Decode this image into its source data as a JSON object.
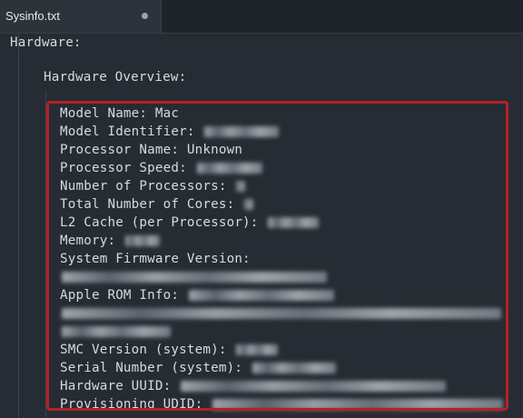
{
  "tab": {
    "title": "Sysinfo.txt"
  },
  "lines": {
    "hardware": "Hardware:",
    "overview": "Hardware Overview:",
    "model_name": "Model Name: Mac",
    "model_identifier": "Model Identifier:",
    "processor_name": "Processor Name: Unknown",
    "processor_speed": "Processor Speed:",
    "num_processors": "Number of Processors:",
    "total_cores": "Total Number of Cores:",
    "l2_cache": "L2 Cache (per Processor):",
    "memory": "Memory:",
    "firmware": "System Firmware Version:",
    "rom_info": "Apple ROM Info:",
    "smc": "SMC Version (system):",
    "serial": "Serial Number (system):",
    "uuid": "Hardware UUID:",
    "udid": "Provisioning UDID:"
  },
  "colors": {
    "highlight": "#b62027",
    "background": "#262c33"
  }
}
